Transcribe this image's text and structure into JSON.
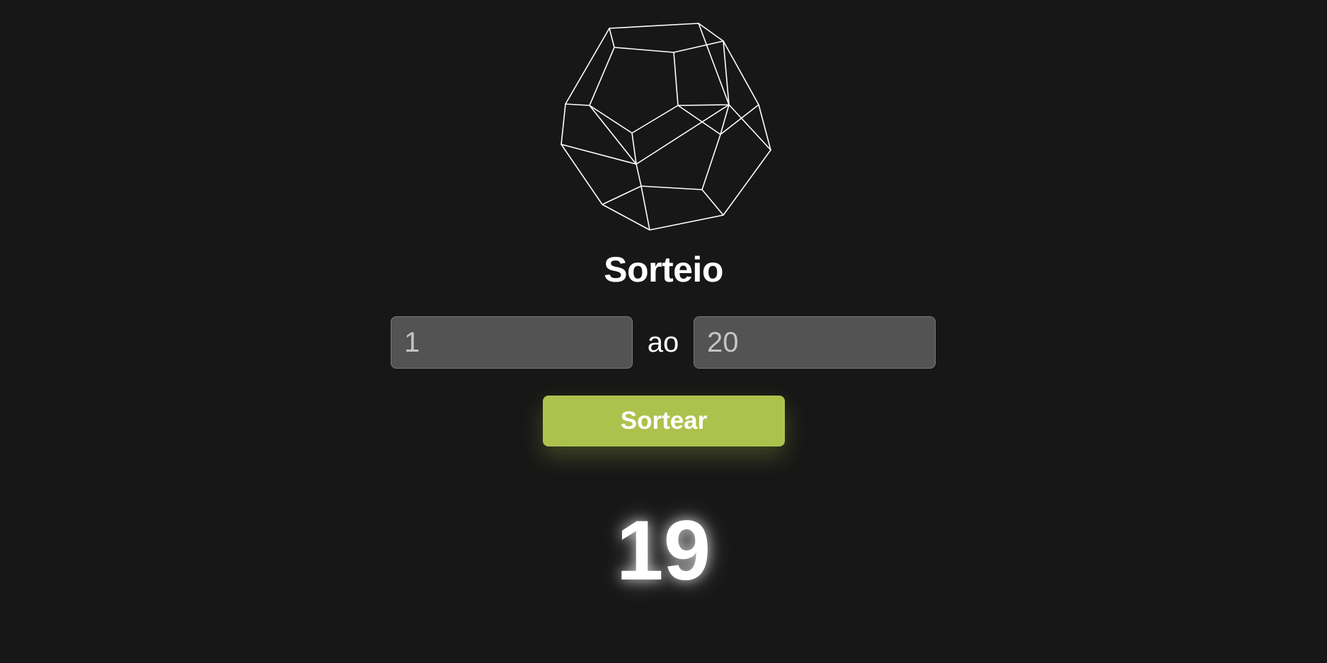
{
  "app": {
    "logo_icon": "dodecahedron-icon",
    "title": "Sorteio"
  },
  "range": {
    "min_value": "1",
    "separator": "ao",
    "max_value": "20"
  },
  "actions": {
    "draw_label": "Sortear"
  },
  "result": {
    "value": "19"
  },
  "colors": {
    "background": "#171717",
    "accent": "#adc24d",
    "input_background": "#535353",
    "text": "#ffffff"
  }
}
